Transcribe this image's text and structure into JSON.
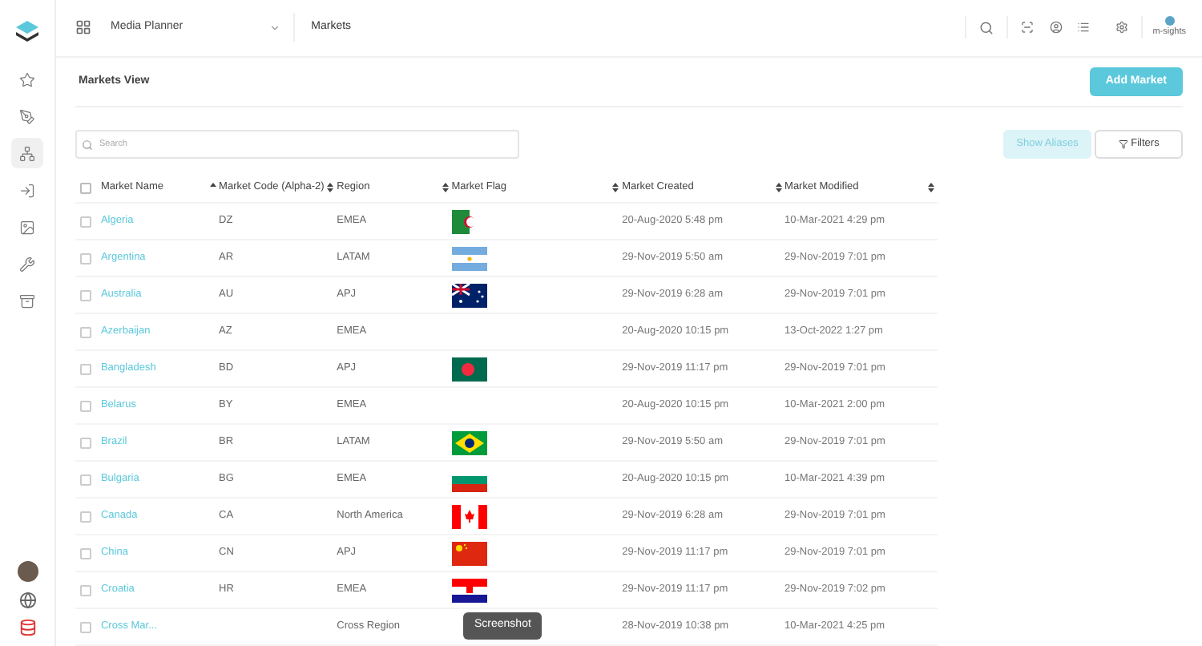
{
  "sidebar": {
    "items": [
      {
        "kind": "star",
        "selected": false
      },
      {
        "kind": "pencil",
        "selected": false
      },
      {
        "kind": "hierarchy",
        "selected": true
      },
      {
        "kind": "login",
        "selected": false
      },
      {
        "kind": "image",
        "selected": false
      },
      {
        "kind": "tools",
        "selected": false
      },
      {
        "kind": "archive",
        "selected": false
      }
    ]
  },
  "header": {
    "app": "Media Planner",
    "page": "Markets",
    "brand": "m-sights"
  },
  "title": "Markets View",
  "add_button": "Add Market",
  "search": {
    "placeholder": "Search"
  },
  "show_aliases": "Show Aliases",
  "filters": "Filters",
  "table": {
    "all_checked": false,
    "columns": [
      {
        "label": "Market Name",
        "sorted": true
      },
      {
        "label": "Market Code (Alpha-2)",
        "sorted": false
      },
      {
        "label": "Region",
        "sorted": false
      },
      {
        "label": "Market Flag",
        "sorted": false
      },
      {
        "label": "Market Created",
        "sorted": false
      },
      {
        "label": "Market Modified",
        "sorted": false
      }
    ],
    "rows": [
      {
        "checked": false,
        "name": "Algeria",
        "code": "DZ",
        "region": "EMEA",
        "flag": {
          "kind": "dz"
        },
        "created": "20-Aug-2020 5:48 pm",
        "modified": "10-Mar-2021 4:29 pm"
      },
      {
        "checked": false,
        "name": "Argentina",
        "code": "AR",
        "region": "LATAM",
        "flag": {
          "kind": "ar"
        },
        "created": "29-Nov-2019 5:50 am",
        "modified": "29-Nov-2019 7:01 pm"
      },
      {
        "checked": false,
        "name": "Australia",
        "code": "AU",
        "region": "APJ",
        "flag": {
          "kind": "au"
        },
        "created": "29-Nov-2019 6:28 am",
        "modified": "29-Nov-2019 7:01 pm"
      },
      {
        "checked": false,
        "name": "Azerbaijan",
        "code": "AZ",
        "region": "EMEA",
        "created": "20-Aug-2020 10:15 pm",
        "modified": "13-Oct-2022 1:27 pm"
      },
      {
        "checked": false,
        "name": "Bangladesh",
        "code": "BD",
        "region": "APJ",
        "flag": {
          "kind": "bd"
        },
        "created": "29-Nov-2019 11:17 pm",
        "modified": "29-Nov-2019 7:01 pm"
      },
      {
        "checked": false,
        "name": "Belarus",
        "code": "BY",
        "region": "EMEA",
        "created": "20-Aug-2020 10:15 pm",
        "modified": "10-Mar-2021 2:00 pm"
      },
      {
        "checked": false,
        "name": "Brazil",
        "code": "BR",
        "region": "LATAM",
        "flag": {
          "kind": "br"
        },
        "created": "29-Nov-2019 5:50 am",
        "modified": "29-Nov-2019 7:01 pm"
      },
      {
        "checked": false,
        "name": "Bulgaria",
        "code": "BG",
        "region": "EMEA",
        "flag": {
          "kind": "bg"
        },
        "created": "20-Aug-2020 10:15 pm",
        "modified": "10-Mar-2021 4:39 pm"
      },
      {
        "checked": false,
        "name": "Canada",
        "code": "CA",
        "region": "North America",
        "flag": {
          "kind": "ca"
        },
        "created": "29-Nov-2019 6:28 am",
        "modified": "29-Nov-2019 7:01 pm"
      },
      {
        "checked": false,
        "name": "China",
        "code": "CN",
        "region": "APJ",
        "flag": {
          "kind": "cn"
        },
        "created": "29-Nov-2019 11:17 pm",
        "modified": "29-Nov-2019 7:01 pm"
      },
      {
        "checked": false,
        "name": "Croatia",
        "code": "HR",
        "region": "EMEA",
        "flag": {
          "kind": "hr"
        },
        "created": "29-Nov-2019 11:17 pm",
        "modified": "29-Nov-2019 7:02 pm"
      },
      {
        "checked": false,
        "name": "Cross Mar...",
        "region": "Cross Region",
        "created": "28-Nov-2019 10:38 pm",
        "modified": "10-Mar-2021 4:25 pm"
      }
    ]
  },
  "tooltip": "Screenshot"
}
